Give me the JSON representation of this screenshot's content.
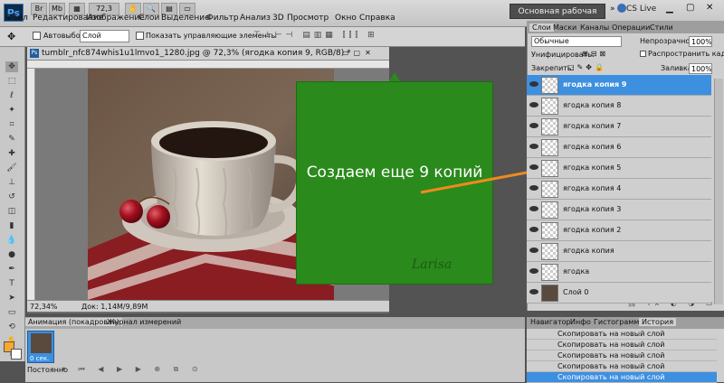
{
  "app": {
    "logo": "Ps",
    "zoom": "72,3",
    "workspace": "Основная рабочая среда",
    "cslive": "CS Live"
  },
  "menu": [
    "Файл",
    "Редактирование",
    "Изображение",
    "Слои",
    "Выделение",
    "Фильтр",
    "Анализ",
    "3D",
    "Просмотр",
    "Окно",
    "Справка"
  ],
  "options": {
    "autoselect_label": "Автовыбор:",
    "autoselect_value": "Слой",
    "show_controls": "Показать управляющие элементы"
  },
  "document": {
    "tab_title": "tumblr_nfc874whis1u1lmvo1_1280.jpg @ 72,3% (ягодка копия 9, RGB/8) *",
    "zoom_status": "72,34%",
    "doc_status": "Док: 1,14М/9,89М",
    "watermark": "Larisa"
  },
  "callout": {
    "text": "Создаем еще 9 копий",
    "arrow_color": "#f08a1c",
    "box_color": "#2a8a1c"
  },
  "animation": {
    "tabs": [
      "Анимация (покадровая)",
      "Журнал измерений"
    ],
    "frame_label": "0 сек.",
    "loop": "Постоянно"
  },
  "layers_panel": {
    "tabs": [
      "Слои",
      "Маски",
      "Каналы",
      "Операции",
      "Стили"
    ],
    "blend_mode": "Обычные",
    "opacity_label": "Непрозрачность:",
    "opacity_value": "100%",
    "unify_label": "Унифицировать:",
    "propagate_label": "Распространить кадр 1",
    "lock_label": "Закрепить:",
    "fill_label": "Заливка:",
    "fill_value": "100%",
    "layers": [
      "ягодка копия 9",
      "ягодка копия 8",
      "ягодка копия 7",
      "ягодка копия 6",
      "ягодка копия 5",
      "ягодка копия 4",
      "ягодка копия 3",
      "ягодка копия 2",
      "ягодка копия",
      "ягодка",
      "Слой 0"
    ]
  },
  "history_panel": {
    "tabs": [
      "Навигатор",
      "Инфо",
      "Гистограмма",
      "История"
    ],
    "items": [
      "Скопировать на новый слой",
      "Скопировать на новый слой",
      "Скопировать на новый слой",
      "Скопировать на новый слой",
      "Скопировать на новый слой",
      "Скопировать на новый слой"
    ]
  }
}
